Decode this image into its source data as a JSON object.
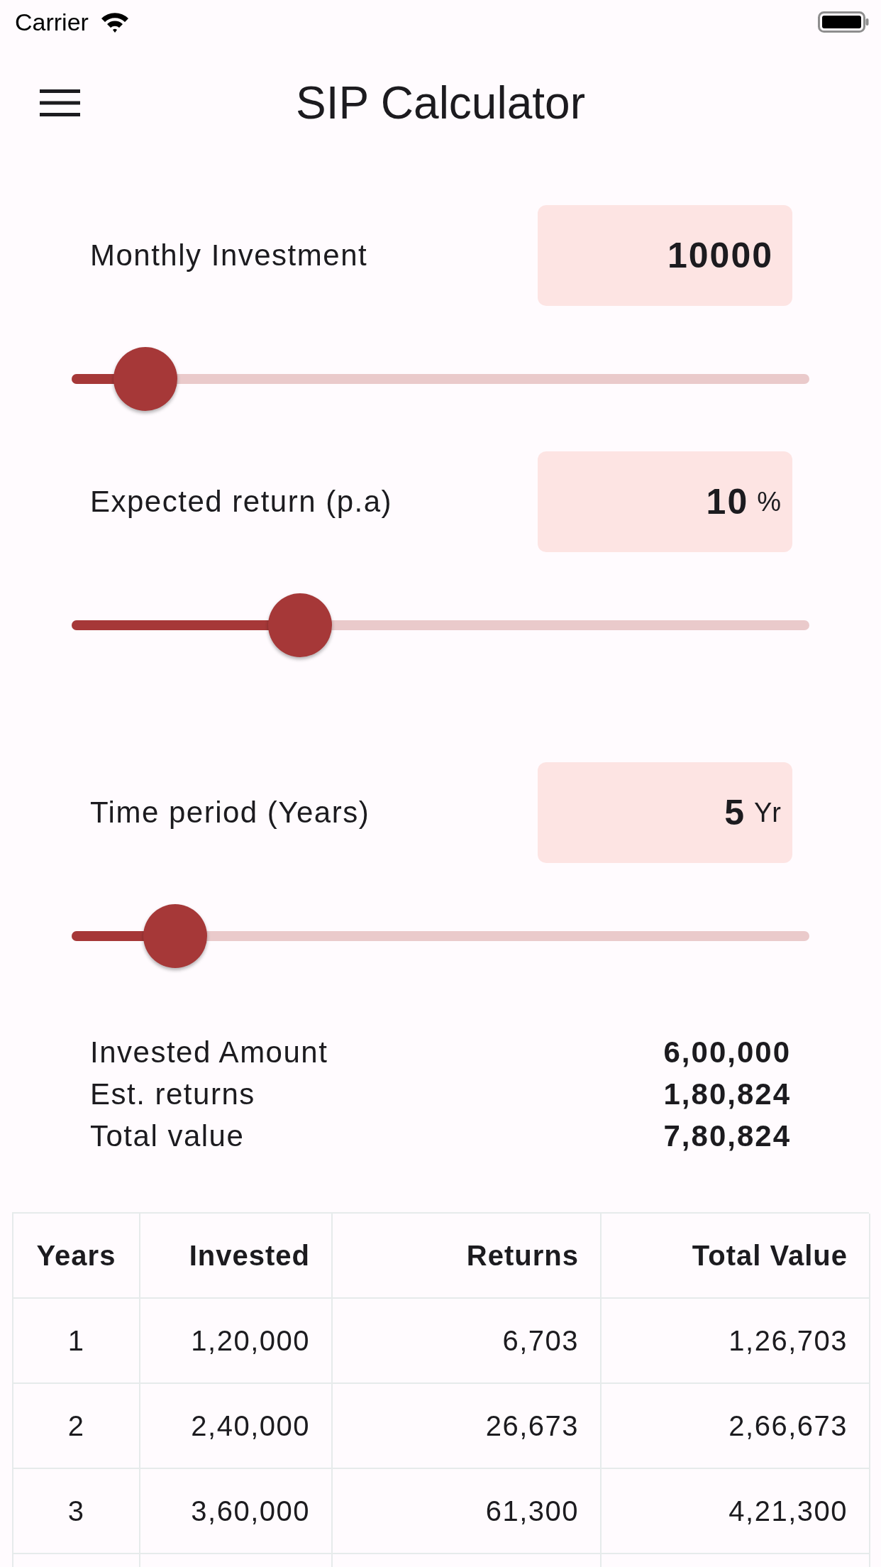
{
  "status_bar": {
    "carrier": "Carrier"
  },
  "app_bar": {
    "title": "SIP Calculator"
  },
  "inputs": [
    {
      "label": "Monthly Investment",
      "value": "10000",
      "level": 0.1
    },
    {
      "label": "Expected return (p.a)",
      "value": "10",
      "unit": "%",
      "level": 0.31
    },
    {
      "label": "Time period (Years)",
      "value": "5",
      "unit": "Yr",
      "level": 0.14
    }
  ],
  "summary": [
    {
      "label": "Invested Amount",
      "value": "6,00,000"
    },
    {
      "label": "Est. returns",
      "value": "1,80,824"
    },
    {
      "label": "Total value",
      "value": "7,80,824"
    }
  ],
  "table": {
    "columns": [
      "Years",
      "Invested",
      "Returns",
      "Total Value"
    ],
    "rows": [
      [
        "1",
        "1,20,000",
        "6,703",
        "1,26,703"
      ],
      [
        "2",
        "2,40,000",
        "26,673",
        "2,66,673"
      ],
      [
        "3",
        "3,60,000",
        "61,300",
        "4,21,300"
      ]
    ]
  }
}
